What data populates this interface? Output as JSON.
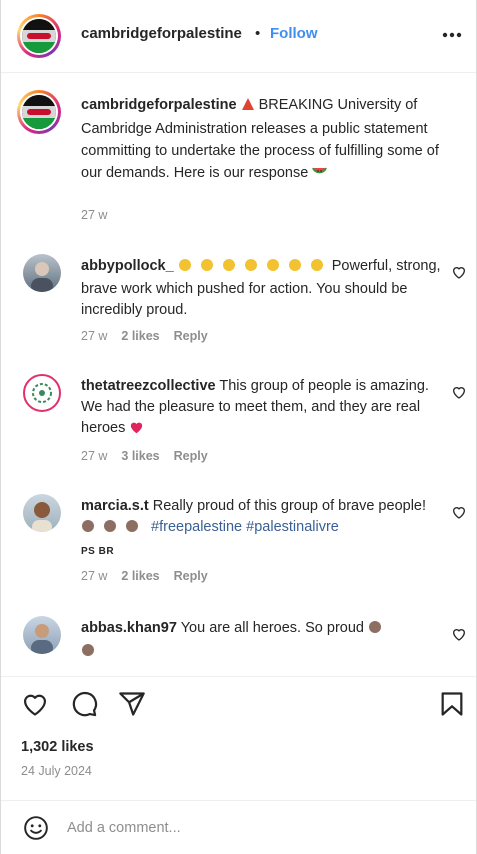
{
  "header": {
    "username": "cambridgeforpalestine",
    "separator": "•",
    "follow_label": "Follow",
    "more_icon": "more-horizontal-icon"
  },
  "caption": {
    "username": "cambridgeforpalestine",
    "text": "BREAKING University of Cambridge Administration releases a public statement committing to undertake the process of fulfilling some of our demands. Here is our response",
    "time": "27 w"
  },
  "comments": [
    {
      "username": "abbypollock_",
      "text": "Powerful, strong, brave work which pushed for action. You should be incredibly proud.",
      "time": "27 w",
      "likes": "2 likes",
      "reply": "Reply"
    },
    {
      "username": "thetatreezcollective",
      "text": "This group of people is amazing. We had the pleasure to meet them, and they are real heroes",
      "time": "27 w",
      "likes": "3 likes",
      "reply": "Reply"
    },
    {
      "username": "marcia.s.t",
      "text": "Really proud of this group of brave people!",
      "hashtags": [
        "#freepalestine",
        "#palestinalivre"
      ],
      "flags": "PS BR",
      "time": "27 w",
      "likes": "2 likes",
      "reply": "Reply"
    },
    {
      "username": "abbas.khan97",
      "text": "You are all heroes. So proud"
    }
  ],
  "actions": {
    "like_icon": "heart-icon",
    "comment_icon": "comment-icon",
    "share_icon": "share-icon",
    "save_icon": "bookmark-icon"
  },
  "likes_count": "1,302 likes",
  "post_date": "24 July 2024",
  "comment_box": {
    "placeholder": "Add a comment...",
    "emoji_icon": "smile-icon"
  },
  "colors": {
    "follow": "#3f8ef0",
    "hashtag": "#3a5f94",
    "muted": "#8e8e8e",
    "heart_emoji": "#e0245e"
  }
}
